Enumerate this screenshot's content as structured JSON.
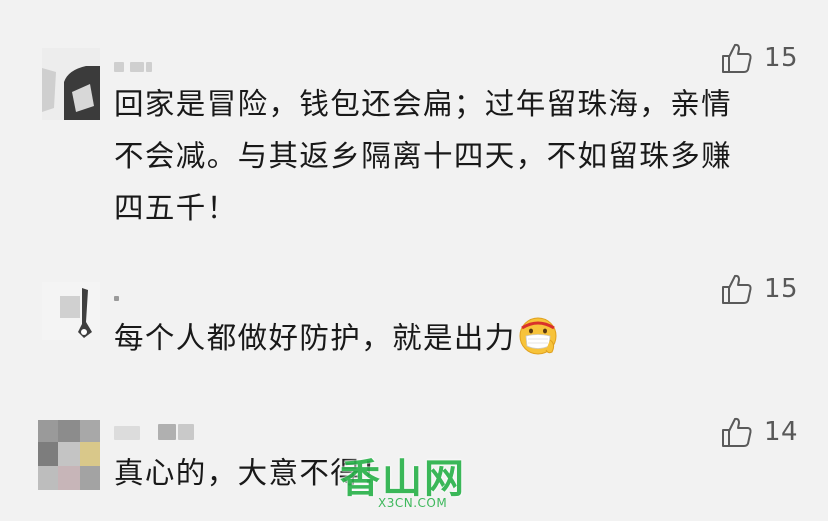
{
  "comments": [
    {
      "text_lines": [
        "回家是冒险，钱包还会扁；过年留珠海，亲情",
        "不会减。与其返乡隔离十四天，不如留珠多赚",
        "四五千！"
      ],
      "likes": "15",
      "like_icon": "thumbs-up-icon",
      "avatar_colors": [
        "#3b3b3b",
        "#d8d8d8"
      ]
    },
    {
      "text": "每个人都做好防护，就是出力",
      "emoji": "mask-face-emoji",
      "likes": "15",
      "like_icon": "thumbs-up-icon",
      "avatar_colors": [
        "#3f3f3f",
        "#e4e4e4"
      ]
    },
    {
      "text": "真心的，大意不得！",
      "likes": "14",
      "like_icon": "thumbs-up-icon",
      "avatar_colors": [
        "#8c8c8c",
        "#d9c88a",
        "#c7b5b8"
      ]
    }
  ],
  "watermark": {
    "logo": "香山网",
    "url": "X3CN.COM",
    "color": "#2bb24c"
  },
  "colors": {
    "background": "#f2f2f2",
    "text": "#191919",
    "like": "#585858"
  }
}
